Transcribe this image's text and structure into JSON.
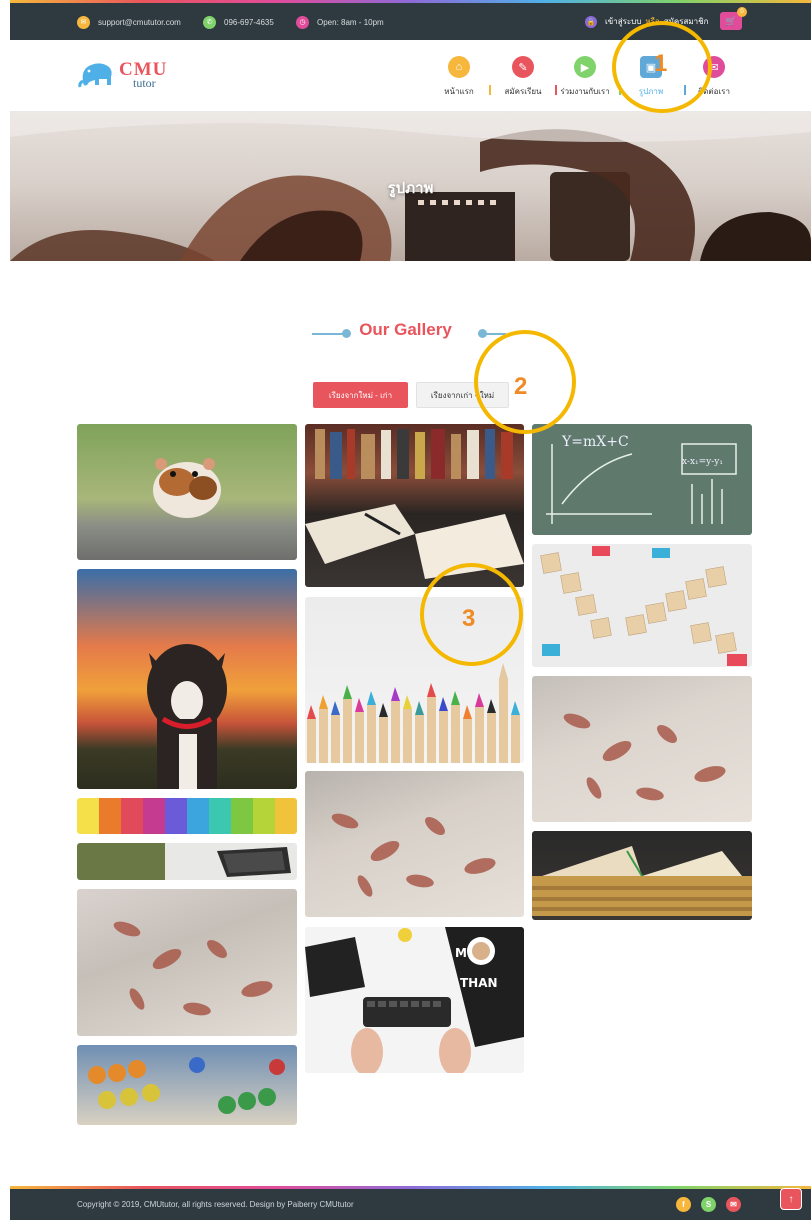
{
  "topbar": {
    "email": "support@cmututor.com",
    "phone": "096-697-4635",
    "hours": "Open: 8am - 10pm",
    "login": "เข้าสู่ระบบ",
    "or": "หรือ",
    "register": "สมัครสมาชิก",
    "cart_count": "0"
  },
  "logo": {
    "cmu": "CMU",
    "tutor": "tutor"
  },
  "nav": [
    {
      "label": "หน้าแรก",
      "icon": "home-icon",
      "color": "#f6b73c"
    },
    {
      "label": "สมัครเรียน",
      "icon": "pencil-icon",
      "color": "#e9555d"
    },
    {
      "label": "ร่วมงานกับเรา",
      "icon": "video-icon",
      "color": "#7fd36a"
    },
    {
      "label": "รูปภาพ",
      "icon": "image-icon",
      "color": "#5fa8d8"
    },
    {
      "label": "ติดต่อเรา",
      "icon": "mail-icon",
      "color": "#e04c9a"
    }
  ],
  "banner": {
    "title": "รูปภาพ"
  },
  "gallery": {
    "title": "Our Gallery",
    "sort_new": "เรียงจากใหม่ - เก่า",
    "sort_old": "เรียงจากเก่า - ใหม่",
    "photos": [
      "hamster",
      "dog-sunset",
      "crayons",
      "laptop-desk",
      "pencil-shavings-1",
      "abacus",
      "open-book",
      "colored-pencils",
      "pencil-shavings-2",
      "keyboard-workspace",
      "math-chalkboard",
      "scrabble-learn-math",
      "pencil-shavings-3",
      "old-books"
    ]
  },
  "annotations": [
    "1",
    "2",
    "3"
  ],
  "footer": {
    "copyright": "Copyright © 2019, CMUtutor, all rights reserved. Design by Paiberry CMUtutor",
    "social": [
      "facebook-icon",
      "skype-icon",
      "mail-icon"
    ]
  },
  "colors": {
    "accent": "#e9555d",
    "dark": "#2e3a3f",
    "blue": "#4fb0e8"
  }
}
